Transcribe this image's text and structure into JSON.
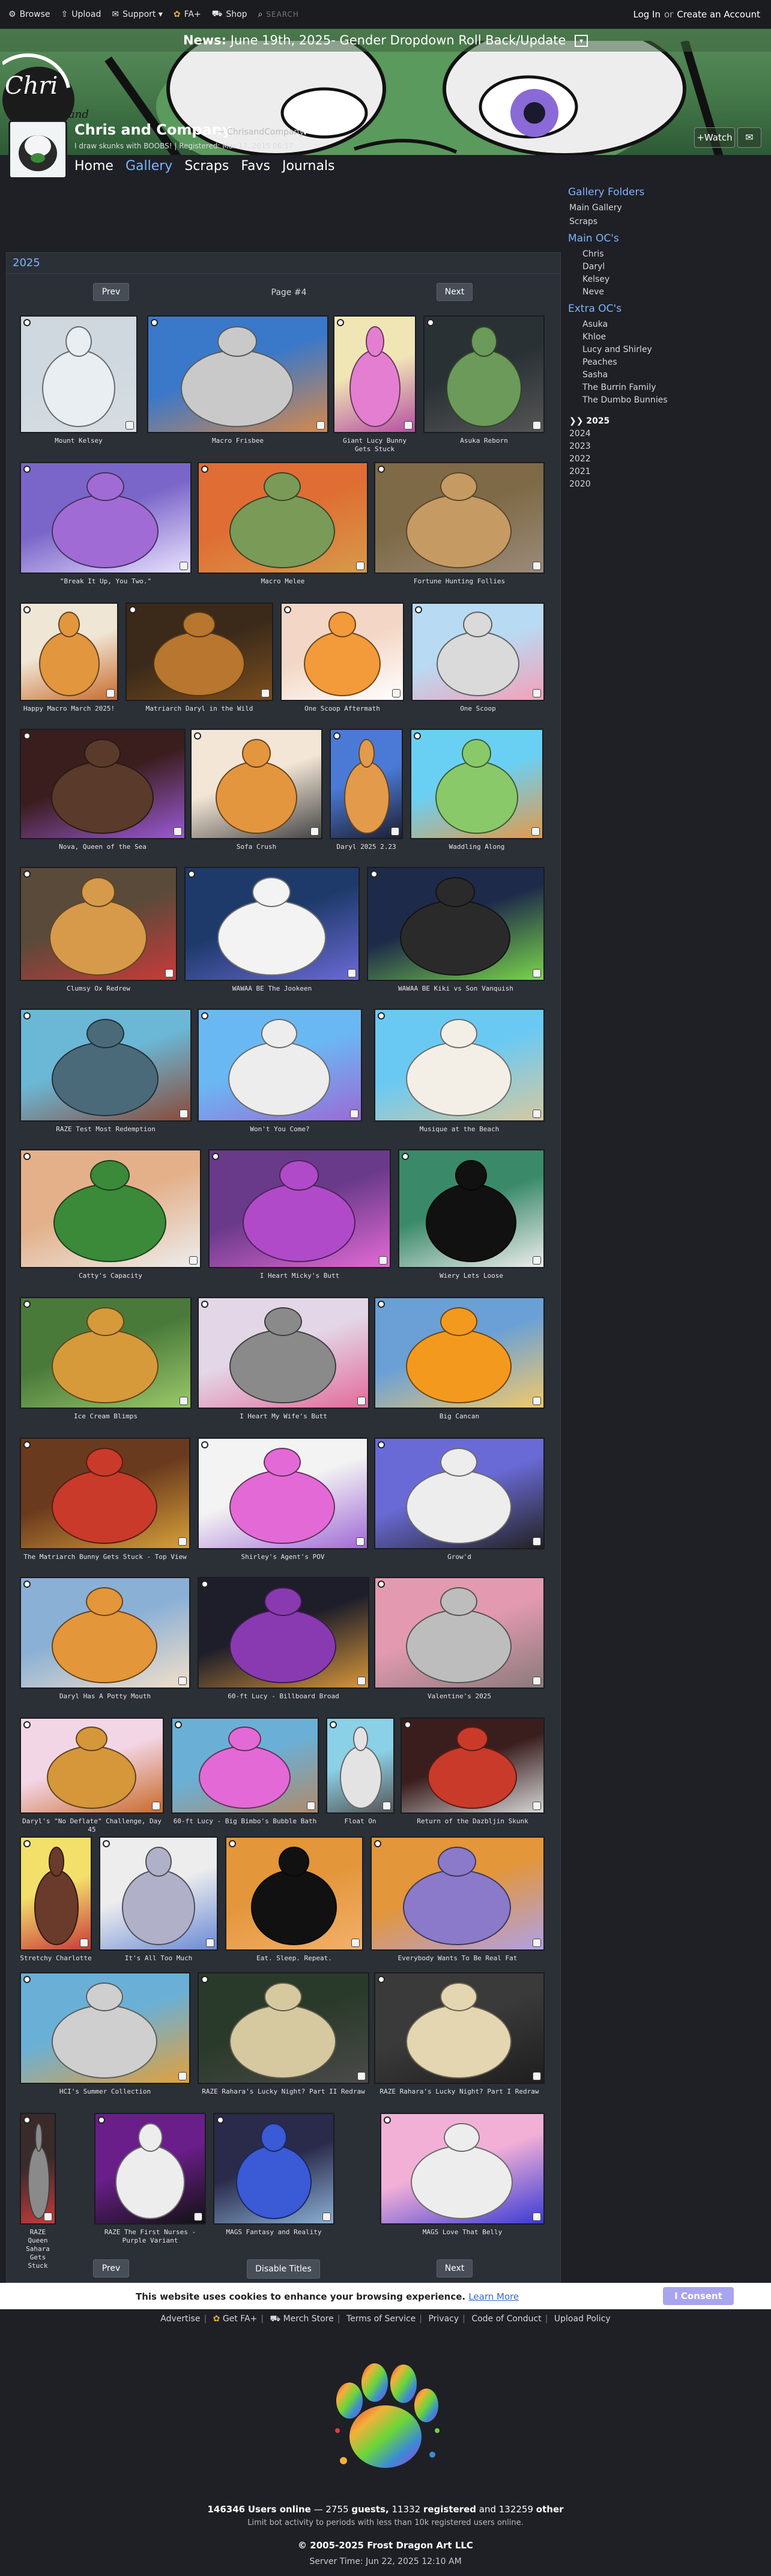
{
  "topnav": {
    "browse": "Browse",
    "upload": "Upload",
    "support": "Support ▾",
    "faplus": "FA+",
    "shop": "Shop",
    "search_placeholder": "SEARCH",
    "login": "Log In",
    "or": "or",
    "create": "Create an Account"
  },
  "banner": {
    "news_label": "News:",
    "news_text": "June 19th, 2025- Gender Dropdown Roll Back/Update"
  },
  "profile": {
    "name": "Chris and Company",
    "handle": "~ ChrisandCompany",
    "status": "I draw skunks with BOOBS! | Registered: Mar 17, 2015 06:17",
    "watch": "+Watch",
    "tabs": [
      "Home",
      "Gallery",
      "Scraps",
      "Favs",
      "Journals"
    ]
  },
  "gallery": {
    "title": "2025",
    "prev": "Prev",
    "next": "Next",
    "page": "Page #4",
    "disable_titles": "Disable Titles",
    "items": [
      {
        "title": "Mount Kelsey",
        "c1": "#cfd8df",
        "c2": "#e9eef2",
        "c3": "#d7dde2"
      },
      {
        "title": "Macro Frisbee",
        "c1": "#3a78c9",
        "c2": "#c9c9c9",
        "c3": "#d6894a"
      },
      {
        "title": "Giant Lucy Bunny Gets Stuck",
        "c1": "#f0e6b5",
        "c2": "#e47ed1",
        "c3": "#b54ea2"
      },
      {
        "title": "Asuka Reborn",
        "c1": "#2a3135",
        "c2": "#6c9a5a",
        "c3": "#555"
      },
      {
        "title": "\"Break It Up, You Two.\"",
        "c1": "#7a66c9",
        "c2": "#a16bd6",
        "c3": "#e9e2ff"
      },
      {
        "title": "Macro Melee",
        "c1": "#e06d33",
        "c2": "#7a9a58",
        "c3": "#d69a4a"
      },
      {
        "title": "Fortune Hunting Follies",
        "c1": "#7e6a46",
        "c2": "#c69a63",
        "c3": "#9a8a7a"
      },
      {
        "title": "Happy Macro March 2025!",
        "c1": "#f0e6d5",
        "c2": "#e2963e",
        "c3": "#c96b2c"
      },
      {
        "title": "Matriarch Daryl in the Wild",
        "c1": "#3b2a1a",
        "c2": "#b8762e",
        "c3": "#7a4e1e"
      },
      {
        "title": "One Scoop Aftermath",
        "c1": "#f3d6c5",
        "c2": "#f39a3a",
        "c3": "#ffffff"
      },
      {
        "title": "One Scoop",
        "c1": "#b8dbf3",
        "c2": "#dadada",
        "c3": "#f3a0b8"
      },
      {
        "title": "Nova, Queen of the Sea",
        "c1": "#3a1d1d",
        "c2": "#5a3a2a",
        "c3": "#9a5ad6"
      },
      {
        "title": "Sofa Crush",
        "c1": "#f3e6d6",
        "c2": "#e4963e",
        "c3": "#444"
      },
      {
        "title": "Daryl 2025 2.23",
        "c1": "#4a7ad6",
        "c2": "#e39a4a",
        "c3": "#1e1e2e"
      },
      {
        "title": "Waddling Along",
        "c1": "#6ad0f3",
        "c2": "#8ac96a",
        "c3": "#e39a4a"
      },
      {
        "title": "Clumsy Ox Redrew",
        "c1": "#5a4a3a",
        "c2": "#d69a4a",
        "c3": "#c93a3a"
      },
      {
        "title": "WAWAA BE The Jookeen",
        "c1": "#1e3a6a",
        "c2": "#f3f3f3",
        "c3": "#6a6ad6"
      },
      {
        "title": "WAWAA BE Kiki vs Son Vanquish",
        "c1": "#1e2a4a",
        "c2": "#2a2a2a",
        "c3": "#7ad64a"
      },
      {
        "title": "RAZE Test Most Redemption",
        "c1": "#6ab8d6",
        "c2": "#4a6a7a",
        "c3": "#8a4a3a"
      },
      {
        "title": "Won't You Come?",
        "c1": "#6ab8f3",
        "c2": "#ededed",
        "c3": "#9a6ad6"
      },
      {
        "title": "Musique at the Beach",
        "c1": "#6ac9f3",
        "c2": "#f3efe6",
        "c3": "#d6c9a0"
      },
      {
        "title": "Catty's Capacity",
        "c1": "#e3b08a",
        "c2": "#3a8a3a",
        "c3": "#ededed"
      },
      {
        "title": "I Heart Micky's Butt",
        "c1": "#6a3a8a",
        "c2": "#b04ac9",
        "c3": "#e36ad6"
      },
      {
        "title": "Wiery Lets Loose",
        "c1": "#3a8a6a",
        "c2": "#111",
        "c3": "#ededed"
      },
      {
        "title": "Ice Cream Blimps",
        "c1": "#4a7a3a",
        "c2": "#d69a3a",
        "c3": "#9ac96a"
      },
      {
        "title": "I Heart My Wife's Butt",
        "c1": "#e3d6e6",
        "c2": "#8a8a8a",
        "c3": "#e36a9a"
      },
      {
        "title": "Big Cancan",
        "c1": "#6aa0d6",
        "c2": "#f39a1e",
        "c3": "#f3c96a"
      },
      {
        "title": "The Matriarch Bunny Gets Stuck - Top View",
        "c1": "#6a3a1e",
        "c2": "#c93a2a",
        "c3": "#d6a03a"
      },
      {
        "title": "Shirley's Agent's POV",
        "c1": "#f3f3f3",
        "c2": "#e36ad6",
        "c3": "#a06ad6"
      },
      {
        "title": "Grow'd",
        "c1": "#6a6ad6",
        "c2": "#ededed",
        "c3": "#222"
      },
      {
        "title": "Daryl Has A Potty Mouth",
        "c1": "#8ab0d6",
        "c2": "#e3963a",
        "c3": "#f3e0c9"
      },
      {
        "title": "60-ft Lucy - Billboard Broad",
        "c1": "#1e1e2a",
        "c2": "#8a3ab0",
        "c3": "#d6963a"
      },
      {
        "title": "Valentine's 2025",
        "c1": "#e39ab0",
        "c2": "#bdbdbd",
        "c3": "#8a7a7a"
      },
      {
        "title": "Daryl's \"No Deflate\" Challenge, Day 45",
        "c1": "#f3d6e6",
        "c2": "#d6963a",
        "c3": "#c96a2a"
      },
      {
        "title": "60-ft Lucy - Big Bimbo's Bubble Bath",
        "c1": "#6ab0d6",
        "c2": "#e36ad6",
        "c3": "#b08a6a"
      },
      {
        "title": "Float On",
        "c1": "#8ad0e6",
        "c2": "#e3e3e3",
        "c3": "#555"
      },
      {
        "title": "Return of the Dazbljin Skunk",
        "c1": "#3a1e1e",
        "c2": "#c93a2a",
        "c3": "#d6d6d6"
      },
      {
        "title": "Stretchy Charlotte",
        "c1": "#f3e06a",
        "c2": "#6a3a2a",
        "c3": "#c93a3a"
      },
      {
        "title": "It's All Too Much",
        "c1": "#ededed",
        "c2": "#b0b0c9",
        "c3": "#6a8ad6"
      },
      {
        "title": "Eat. Sleep. Repeat.",
        "c1": "#e3963a",
        "c2": "#111",
        "c3": "#f3b06a"
      },
      {
        "title": "Everybody Wants To Be Real Fat",
        "c1": "#e3963a",
        "c2": "#8a7ac9",
        "c3": "#b0a0e6"
      },
      {
        "title": "HCI's Summer Collection",
        "c1": "#6ab0d6",
        "c2": "#cfcfcf",
        "c3": "#e3a03a"
      },
      {
        "title": "RAZE Rahara's Lucky Night? Part II Redraw",
        "c1": "#2a3a2a",
        "c2": "#d6c9a0",
        "c3": "#4a4a4a"
      },
      {
        "title": "RAZE Rahara's Lucky Night? Part I Redraw",
        "c1": "#3a3a3a",
        "c2": "#e3d6b0",
        "c3": "#1e1e1e"
      },
      {
        "title": "RAZE Queen Sahara Gets Stuck",
        "c1": "#3a2a2a",
        "c2": "#8a8a8a",
        "c3": "#c93a3a"
      },
      {
        "title": "RAZE The First Nurses - Purple Variant",
        "c1": "#6a1e8a",
        "c2": "#ededed",
        "c3": "#111"
      },
      {
        "title": "MAGS Fantasy and Reality",
        "c1": "#2a2a4a",
        "c2": "#3a5ad6",
        "c3": "#8ab0d6"
      },
      {
        "title": "MAGS Love That Belly",
        "c1": "#f3b0d6",
        "c2": "#ededed",
        "c3": "#3a3ad6"
      }
    ]
  },
  "sidebar": {
    "gallery_folders": "Gallery Folders",
    "main_gallery": "Main Gallery",
    "scraps": "Scraps",
    "main_ocs_header": "Main OC's",
    "main_ocs": [
      "Chris",
      "Daryl",
      "Kelsey",
      "Neve"
    ],
    "extra_ocs_header": "Extra OC's",
    "extra_ocs": [
      "Asuka",
      "Khloe",
      "Lucy and Shirley",
      "Peaches",
      "Sasha",
      "The Burrin Family",
      "The Dumbo Bunnies"
    ],
    "years": [
      "❯❯ 2025",
      "2024",
      "2023",
      "2022",
      "2021",
      "2020"
    ]
  },
  "cookie": {
    "text": "This website uses cookies to enhance your browsing experience.",
    "link": "Learn More",
    "button": "I Consent"
  },
  "footer": {
    "links": [
      "Advertise",
      "Get FA+",
      "Merch Store",
      "Terms of Service",
      "Privacy",
      "Code of Conduct",
      "Upload Policy"
    ],
    "online_total": "146346",
    "online_label": "Users online",
    "guests_count": "2755",
    "guests_label": "guests,",
    "registered_count": "11332",
    "registered_label": "registered",
    "other_text": "and 132259",
    "other_label": "other",
    "online_note": "Limit bot activity to periods with less than 10k registered users online.",
    "copyright": "© 2005-2025 Frost Dragon Art LLC",
    "server_time": "Server Time: Jun 22, 2025 12:10 AM"
  },
  "colors": {
    "accent_link": "#7fb4ff",
    "consent_button": "#a9a4ee",
    "panel_bg": "#2b2f36"
  }
}
